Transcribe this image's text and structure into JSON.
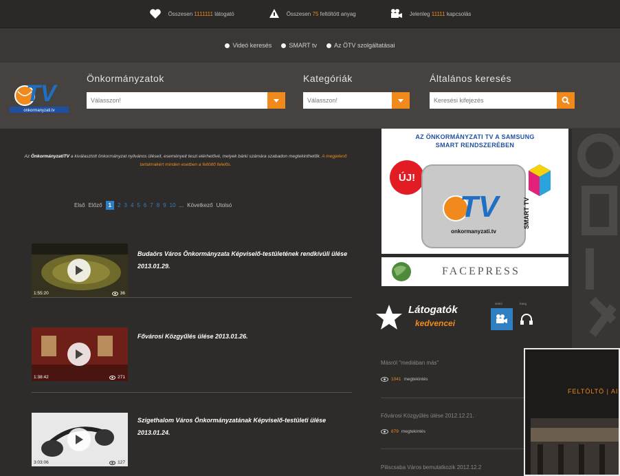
{
  "top_stats": [
    {
      "icon": "heart-icon",
      "prefix": "Összesen",
      "value": "1111111",
      "suffix": "látogató"
    },
    {
      "icon": "upload-icon",
      "prefix": "Összesen",
      "value": "75",
      "suffix": "feltöltött anyag"
    },
    {
      "icon": "camera-icon",
      "prefix": "Jelenleg",
      "value": "11111",
      "suffix": "kapcsolás"
    }
  ],
  "nav_links": [
    {
      "label": "Videó keresés"
    },
    {
      "label": "SMART tv"
    },
    {
      "label": "Az ÖTV szolgáltatásai"
    }
  ],
  "search": {
    "municipalities": {
      "label": "Önkormányzatok",
      "placeholder": "Válasszon!"
    },
    "categories": {
      "label": "Kategóriák",
      "placeholder": "Válasszon!"
    },
    "general": {
      "label": "Általános keresés",
      "placeholder": "Keresési kifejezés"
    }
  },
  "logo": {
    "text": "TV",
    "caption": "onkormanyzati.tv"
  },
  "intro": {
    "brand": "ÖnkormányzatiTV",
    "prefix": "Az",
    "body": "a kiválasztott önkormányzat nyilvános üléseit, eseményeit teszi elérhetővé, melyek bárki számára szabadon megtekinthetők.",
    "highlight": "A megjelenő tartalmakért minden esetben a feltöltő felelős."
  },
  "pagination": {
    "first": "Első",
    "prev": "Előző",
    "current": "1",
    "pages": [
      "2",
      "3",
      "4",
      "5",
      "6",
      "7",
      "8",
      "9",
      "10"
    ],
    "ellipsis": "...",
    "next": "Következő",
    "last": "Utolsó"
  },
  "videos": [
    {
      "title": "Budaörs Város Önkormányzata Képviselő-testületének rendkívüli ülése 2013.01.29.",
      "duration": "1:55:20",
      "views": "36"
    },
    {
      "title": "Fővárosi Közgyűlés ülése 2013.01.26.",
      "duration": "1:38:42",
      "views": "271"
    },
    {
      "title": "Szigethalom Város Önkormányzatának Képviselő-testületi ülése 2013.01.24.",
      "duration": "3:03:06",
      "views": "127"
    }
  ],
  "banner": {
    "headline_line1": "AZ ÖNKORMÁNYZATI TV A SAMSUNG",
    "headline_line2": "SMART RENDSZERÉBEN",
    "badge": "ÚJ!",
    "tv_text": "TV",
    "site": "onkormanyzati.tv",
    "smart_tv": "SMART TV"
  },
  "facepress": {
    "label": "FACEPRESS"
  },
  "favorites": {
    "title": "Látogatók",
    "subtitle": "kedvencei",
    "btn_video_caption": "videó",
    "btn_audio_caption": "hang"
  },
  "side_items": [
    {
      "title": "Másról \"mediában más\"",
      "views": "1041",
      "views_label": "megtekintés"
    },
    {
      "title": "Fővárosi Közgyűlés ülése 2012.12.21.",
      "views": "879",
      "views_label": "megtekintés"
    },
    {
      "title": "Piliscsaba Város bemutatkozik 2012.12.2",
      "views": "",
      "views_label": ""
    }
  ],
  "overlay": {
    "text": "FELTÖLTÖ | AI"
  },
  "colors": {
    "accent": "#f08a1c",
    "link_blue": "#2f7fc2",
    "bg": "#2e2c2b",
    "header": "#454240"
  }
}
